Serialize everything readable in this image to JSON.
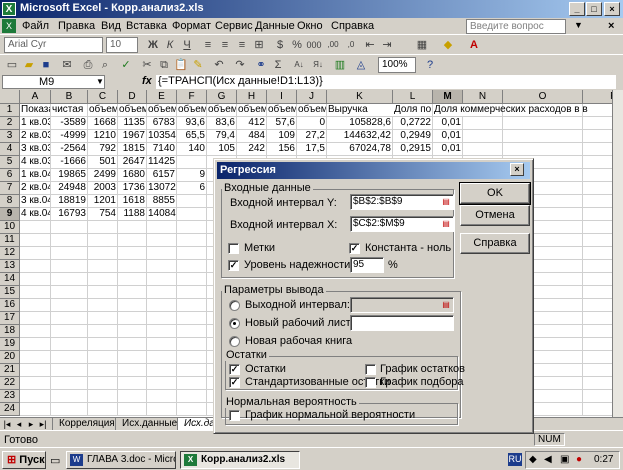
{
  "window": {
    "title": "Microsoft Excel - Корр.анализ2.xls"
  },
  "menu": {
    "items": [
      "Файл",
      "Правка",
      "Вид",
      "Вставка",
      "Формат",
      "Сервис",
      "Данные",
      "Окно",
      "Справка"
    ],
    "help_placeholder": "Введите вопрос"
  },
  "toolbar": {
    "font_name": "Arial Cyr",
    "font_size": "10",
    "zoom": "100%"
  },
  "formula_bar": {
    "cell_ref": "M9",
    "formula": "{=ТРАНСП(Исх данные!D1:L13)}"
  },
  "sheet": {
    "columns": [
      "A",
      "B",
      "C",
      "D",
      "E",
      "F",
      "G",
      "H",
      "I",
      "J",
      "K",
      "L",
      "M",
      "N",
      "O",
      "P"
    ],
    "rows": [
      "1",
      "2",
      "3",
      "4",
      "5",
      "6",
      "7",
      "8",
      "9",
      "10",
      "11",
      "12",
      "13",
      "14",
      "15",
      "16",
      "17",
      "18",
      "19",
      "20",
      "21",
      "22",
      "23",
      "24"
    ],
    "data": [
      [
        "Показател",
        "чистая",
        "объем",
        "объем",
        "объем",
        "объем",
        "объем",
        "объем",
        "объем",
        "объем",
        "Выручка",
        "Доля по",
        "Доля коммерческих расходов в в"
      ],
      [
        "1 кв.03",
        "-3589",
        "1668",
        "1135",
        "6783",
        "93,6",
        "83,6",
        "412",
        "57,6",
        "0",
        "105828,6",
        "0,2722",
        "0,01"
      ],
      [
        "2 кв.03",
        "-4999",
        "1210",
        "1967",
        "10354",
        "65,5",
        "79,4",
        "484",
        "109",
        "27,2",
        "144632,42",
        "0,2949",
        "0,01"
      ],
      [
        "3 кв.03",
        "-2564",
        "792",
        "1815",
        "7140",
        "140",
        "105",
        "242",
        "156",
        "17,5",
        "67024,78",
        "0,2915",
        "0,01"
      ],
      [
        "4 кв.03",
        "-1666",
        "501",
        "2647",
        "11425",
        "",
        "",
        "",
        "",
        "",
        "",
        "",
        ""
      ],
      [
        "1 кв.04",
        "19865",
        "2499",
        "1680",
        "6157",
        "9",
        "",
        "",
        "",
        "",
        "",
        "",
        ""
      ],
      [
        "2 кв.04",
        "24948",
        "2003",
        "1736",
        "13072",
        "6",
        "",
        "",
        "",
        "",
        "",
        "",
        ""
      ],
      [
        "3 кв.04",
        "18819",
        "1201",
        "1618",
        "8855",
        "",
        "",
        "",
        "",
        "",
        "",
        "",
        ""
      ],
      [
        "4 кв.04",
        "16793",
        "754",
        "1188",
        "14084",
        "",
        "",
        "",
        "",
        "",
        "",
        "",
        ""
      ]
    ]
  },
  "tabs": [
    "Корреляция",
    "Исх.данные",
    "Исх.да"
  ],
  "status": {
    "left": "Готово",
    "right": "NUM"
  },
  "taskbar": {
    "start": "Пуск",
    "tasks": [
      "ГЛАВА 3.doc - Microsoft ...",
      "Корр.анализ2.xls"
    ],
    "lang": "RU",
    "clock": "0:27"
  },
  "dialog": {
    "title": "Регрессия",
    "input_group": "Входные данные",
    "input_y_label": "Входной интервал Y:",
    "input_y_value": "$B$2:$B$9",
    "input_x_label": "Входной интервал X:",
    "input_x_value": "$C$2:$M$9",
    "labels_label": "Метки",
    "constant_label": "Константа - ноль",
    "confidence_label": "Уровень надежности:",
    "confidence_value": "95",
    "percent": "%",
    "output_group": "Параметры вывода",
    "output_range_label": "Выходной интервал:",
    "new_sheet_label": "Новый рабочий лист:",
    "new_book_label": "Новая рабочая книга",
    "residuals_group": "Остатки",
    "residuals_label": "Остатки",
    "std_residuals_label": "Стандартизованные остатки",
    "residual_plot_label": "График остатков",
    "fit_plot_label": "График подбора",
    "normal_group": "Нормальная вероятность",
    "normal_plot_label": "График нормальной вероятности",
    "ok_label": "OK",
    "cancel_label": "Отмена",
    "help_label": "Справка",
    "states": {
      "labels": false,
      "constant": true,
      "confidence": true,
      "output_mode": "new_sheet",
      "residuals": true,
      "std_residuals": true,
      "residual_plot": false,
      "fit_plot": false,
      "normal_plot": false
    }
  }
}
